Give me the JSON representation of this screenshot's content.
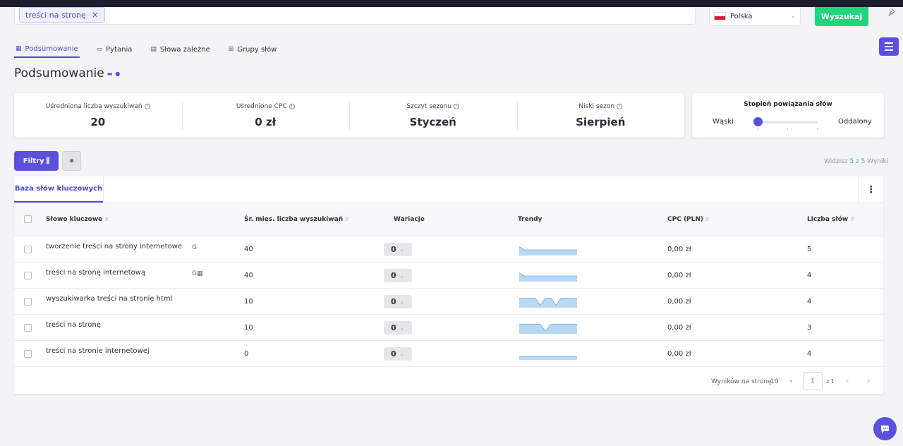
{
  "search": {
    "chip_label": "treści na stronę",
    "chip_remove": "×",
    "country": "Polska",
    "country_chevron": "⌄",
    "button_label": "Wyszukaj"
  },
  "tabs": [
    {
      "label": "Podsumowanie",
      "icon": "grid-icon",
      "active": true
    },
    {
      "label": "Pytania",
      "icon": "chat-bubble-icon"
    },
    {
      "label": "Słowa zależne",
      "icon": "document-icon"
    },
    {
      "label": "Grupy słów",
      "icon": "group-icon"
    }
  ],
  "page_title": "Podsumowanie",
  "stats": [
    {
      "label": "Uśredniona liczba wyszukiwań",
      "value": "20"
    },
    {
      "label": "Uśrednione CPC",
      "value": "0 zł"
    },
    {
      "label": "Szczyt sezonu",
      "value": "Styczeń"
    },
    {
      "label": "Niski sezon",
      "value": "Sierpień"
    }
  ],
  "relation": {
    "title": "Stopień powiązania słów",
    "left_label": "Wąski",
    "right_label": "Oddalony",
    "level": 0
  },
  "filters": {
    "label": "Filtry"
  },
  "results": {
    "prefix": "Widzisz",
    "shown": "5",
    "sep": "z",
    "total": "5",
    "suffix": "Wyniki"
  },
  "table": {
    "tab_label": "Baza słów kluczowych",
    "more_label": "⋮",
    "headers": {
      "keyword": "Słowo kluczowe",
      "volume": "Śr. mies. liczba wyszukiwań",
      "variations": "Wariacje",
      "trends": "Trendy",
      "cpc": "CPC (PLN)",
      "words": "Liczba słów"
    },
    "rows": [
      {
        "keyword": "tworzenie treści na strony internetowe",
        "badge": "G",
        "volume": "40",
        "variations": "0",
        "cpc": "0,00 zł",
        "words": "5",
        "trend": [
          0.9,
          0.55,
          0.55,
          0.55,
          0.55,
          0.55,
          0.55,
          0.55,
          0.55,
          0.55,
          0.55,
          0.55
        ]
      },
      {
        "keyword": "treści na stronę internetową",
        "badge": "G▦",
        "volume": "40",
        "variations": "0",
        "cpc": "0,00 zł",
        "words": "4",
        "trend": [
          0.9,
          0.55,
          0.55,
          0.55,
          0.55,
          0.55,
          0.55,
          0.55,
          0.55,
          0.55,
          0.55,
          0.55
        ]
      },
      {
        "keyword": "wyszukiwarka treści na stronie html",
        "badge": "",
        "volume": "10",
        "variations": "0",
        "cpc": "0,00 zł",
        "words": "4",
        "trend": [
          1,
          1,
          1,
          1,
          0.2,
          1,
          1,
          0.2,
          1,
          1,
          1,
          1
        ]
      },
      {
        "keyword": "treści na stronę",
        "badge": "",
        "volume": "10",
        "variations": "0",
        "cpc": "0,00 zł",
        "words": "3",
        "trend": [
          1,
          1,
          1,
          1,
          1,
          0.2,
          1,
          1,
          1,
          1,
          1,
          1
        ]
      },
      {
        "keyword": "treści na stronie internetowej",
        "badge": "",
        "volume": "0",
        "variations": "0",
        "cpc": "0,00 zł",
        "words": "4",
        "trend": [
          0.3,
          0.3,
          0.3,
          0.3,
          0.3,
          0.3,
          0.3,
          0.3,
          0.3,
          0.3,
          0.3,
          0.3
        ]
      }
    ]
  },
  "pagination": {
    "label": "Wyników na stronę",
    "size": "10",
    "size_chevron": "⌄",
    "page": "1",
    "of": "z 1",
    "prev": "‹",
    "next": "›"
  },
  "colors": {
    "accent": "#5b4fe0",
    "search_button": "#21d47e",
    "trend_fill": "#b9d8f2",
    "trend_line": "#7fb6e6"
  }
}
